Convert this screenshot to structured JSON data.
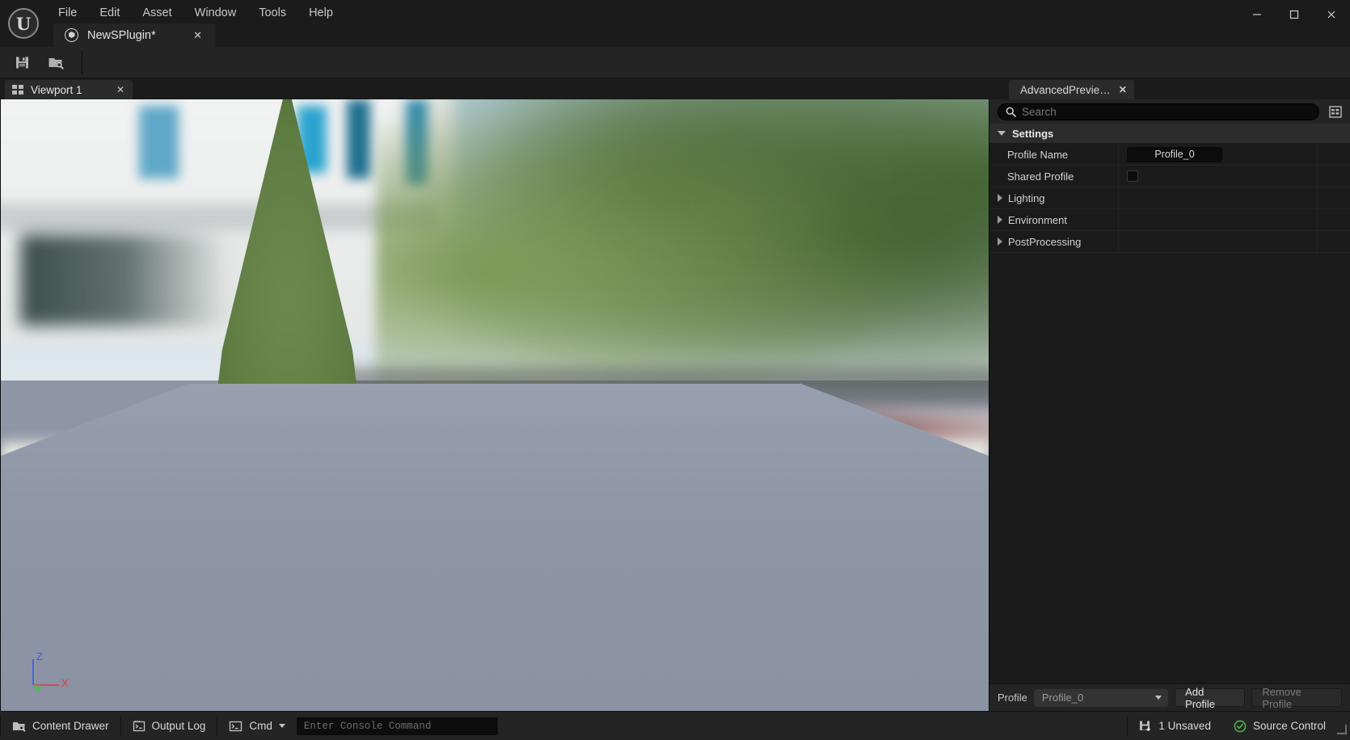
{
  "window": {
    "minimize_label": "minimize",
    "maximize_label": "maximize",
    "close_label": "close"
  },
  "menubar": {
    "items": [
      {
        "label": "File"
      },
      {
        "label": "Edit"
      },
      {
        "label": "Asset"
      },
      {
        "label": "Window"
      },
      {
        "label": "Tools"
      },
      {
        "label": "Help"
      }
    ]
  },
  "document_tab": {
    "label": "NewSPlugin*",
    "close_label": "✕",
    "icon": "asset-sphere-icon"
  },
  "toolbar": {
    "save_label": "Save",
    "browse_label": "Browse"
  },
  "viewport": {
    "tab_label": "Viewport 1",
    "tab_close_label": "✕",
    "gizmo": {
      "x_label": "X",
      "y_label": "Y",
      "z_label": "Z",
      "x_color": "#e03a3a",
      "y_color": "#38c838",
      "z_color": "#3a5ce0"
    },
    "floor_color": "#8e96a7"
  },
  "details": {
    "tab_label": "AdvancedPrevie…",
    "tab_close_label": "✕",
    "search": {
      "placeholder": "Search",
      "value": ""
    },
    "column_button_label": "Column settings",
    "category": {
      "label": "Settings",
      "expanded": true
    },
    "rows": [
      {
        "name": "Profile Name",
        "type": "text",
        "value": "Profile_0",
        "expandable": false
      },
      {
        "name": "Shared Profile",
        "type": "checkbox",
        "value": "",
        "checked": false,
        "expandable": false
      },
      {
        "name": "Lighting",
        "type": "group",
        "value": "",
        "expandable": true
      },
      {
        "name": "Environment",
        "type": "group",
        "value": "",
        "expandable": true
      },
      {
        "name": "PostProcessing",
        "type": "group",
        "value": "",
        "expandable": true
      }
    ],
    "footer": {
      "profile_label": "Profile",
      "profile_value": "Profile_0",
      "add_profile_label": "Add Profile",
      "remove_profile_label": "Remove Profile",
      "remove_profile_disabled": true
    }
  },
  "statusbar": {
    "content_drawer_label": "Content Drawer",
    "output_log_label": "Output Log",
    "cmd_label": "Cmd",
    "console_placeholder": "Enter Console Command",
    "unsaved_label": "1 Unsaved",
    "source_control_label": "Source Control",
    "source_control_color": "#4caf50"
  }
}
